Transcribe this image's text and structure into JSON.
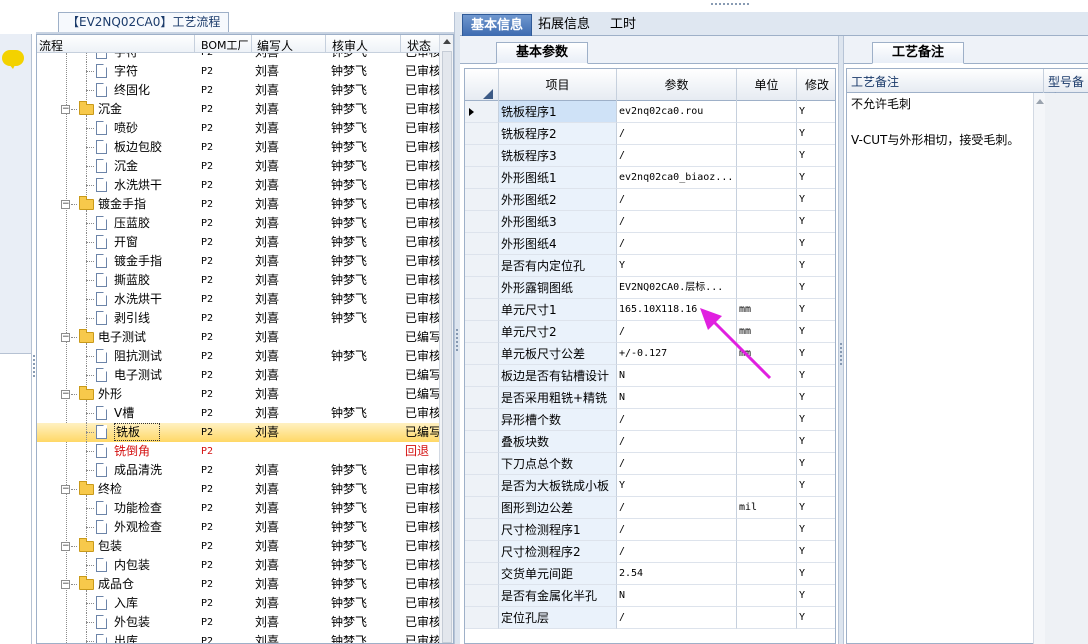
{
  "tree": {
    "title": "【EV2NQ02CA0】工艺流程",
    "headers": [
      "流程",
      "BOM工厂",
      "编写人",
      "核审人",
      "状态"
    ],
    "rows": [
      {
        "level": 2,
        "type": "doc",
        "name": "字符",
        "bom": "P2",
        "writer": "刘喜",
        "reviewer": "钟梦飞",
        "status": "已审核",
        "partial": true
      },
      {
        "level": 2,
        "type": "doc",
        "name": "字符",
        "bom": "P2",
        "writer": "刘喜",
        "reviewer": "钟梦飞",
        "status": "已审核"
      },
      {
        "level": 2,
        "type": "doc",
        "name": "终固化",
        "bom": "P2",
        "writer": "刘喜",
        "reviewer": "钟梦飞",
        "status": "已审核"
      },
      {
        "level": 1,
        "type": "folder",
        "name": "沉金",
        "bom": "P2",
        "writer": "刘喜",
        "reviewer": "钟梦飞",
        "status": "已审核"
      },
      {
        "level": 2,
        "type": "doc",
        "name": "喷砂",
        "bom": "P2",
        "writer": "刘喜",
        "reviewer": "钟梦飞",
        "status": "已审核"
      },
      {
        "level": 2,
        "type": "doc",
        "name": "板边包胶",
        "bom": "P2",
        "writer": "刘喜",
        "reviewer": "钟梦飞",
        "status": "已审核"
      },
      {
        "level": 2,
        "type": "doc",
        "name": "沉金",
        "bom": "P2",
        "writer": "刘喜",
        "reviewer": "钟梦飞",
        "status": "已审核"
      },
      {
        "level": 2,
        "type": "doc",
        "name": "水洗烘干",
        "bom": "P2",
        "writer": "刘喜",
        "reviewer": "钟梦飞",
        "status": "已审核"
      },
      {
        "level": 1,
        "type": "folder",
        "name": "镀金手指",
        "bom": "P2",
        "writer": "刘喜",
        "reviewer": "钟梦飞",
        "status": "已审核"
      },
      {
        "level": 2,
        "type": "doc",
        "name": "压蓝胶",
        "bom": "P2",
        "writer": "刘喜",
        "reviewer": "钟梦飞",
        "status": "已审核"
      },
      {
        "level": 2,
        "type": "doc",
        "name": "开窗",
        "bom": "P2",
        "writer": "刘喜",
        "reviewer": "钟梦飞",
        "status": "已审核"
      },
      {
        "level": 2,
        "type": "doc",
        "name": "镀金手指",
        "bom": "P2",
        "writer": "刘喜",
        "reviewer": "钟梦飞",
        "status": "已审核"
      },
      {
        "level": 2,
        "type": "doc",
        "name": "撕蓝胶",
        "bom": "P2",
        "writer": "刘喜",
        "reviewer": "钟梦飞",
        "status": "已审核"
      },
      {
        "level": 2,
        "type": "doc",
        "name": "水洗烘干",
        "bom": "P2",
        "writer": "刘喜",
        "reviewer": "钟梦飞",
        "status": "已审核"
      },
      {
        "level": 2,
        "type": "doc",
        "name": "剥引线",
        "bom": "P2",
        "writer": "刘喜",
        "reviewer": "钟梦飞",
        "status": "已审核"
      },
      {
        "level": 1,
        "type": "folder",
        "name": "电子测试",
        "bom": "P2",
        "writer": "刘喜",
        "reviewer": "",
        "status": "已编写"
      },
      {
        "level": 2,
        "type": "doc",
        "name": "阻抗测试",
        "bom": "P2",
        "writer": "刘喜",
        "reviewer": "钟梦飞",
        "status": "已审核"
      },
      {
        "level": 2,
        "type": "doc",
        "name": "电子测试",
        "bom": "P2",
        "writer": "刘喜",
        "reviewer": "",
        "status": "已编写"
      },
      {
        "level": 1,
        "type": "folder",
        "name": "外形",
        "bom": "P2",
        "writer": "刘喜",
        "reviewer": "",
        "status": "已编写"
      },
      {
        "level": 2,
        "type": "doc",
        "name": "V槽",
        "bom": "P2",
        "writer": "刘喜",
        "reviewer": "钟梦飞",
        "status": "已审核"
      },
      {
        "level": 2,
        "type": "doc",
        "name": "铣板",
        "bom": "P2",
        "writer": "刘喜",
        "reviewer": "",
        "status": "已编写",
        "selected": true
      },
      {
        "level": 2,
        "type": "doc",
        "name": "铣倒角",
        "bom": "P2",
        "writer": "",
        "reviewer": "",
        "status": "回退",
        "red": true
      },
      {
        "level": 2,
        "type": "doc",
        "name": "成品清洗",
        "bom": "P2",
        "writer": "刘喜",
        "reviewer": "钟梦飞",
        "status": "已审核"
      },
      {
        "level": 1,
        "type": "folder",
        "name": "终检",
        "bom": "P2",
        "writer": "刘喜",
        "reviewer": "钟梦飞",
        "status": "已审核"
      },
      {
        "level": 2,
        "type": "doc",
        "name": "功能检查",
        "bom": "P2",
        "writer": "刘喜",
        "reviewer": "钟梦飞",
        "status": "已审核"
      },
      {
        "level": 2,
        "type": "doc",
        "name": "外观检查",
        "bom": "P2",
        "writer": "刘喜",
        "reviewer": "钟梦飞",
        "status": "已审核"
      },
      {
        "level": 1,
        "type": "folder",
        "name": "包装",
        "bom": "P2",
        "writer": "刘喜",
        "reviewer": "钟梦飞",
        "status": "已审核"
      },
      {
        "level": 2,
        "type": "doc",
        "name": "内包装",
        "bom": "P2",
        "writer": "刘喜",
        "reviewer": "钟梦飞",
        "status": "已审核"
      },
      {
        "level": 1,
        "type": "folder",
        "name": "成品仓",
        "bom": "P2",
        "writer": "刘喜",
        "reviewer": "钟梦飞",
        "status": "已审核"
      },
      {
        "level": 2,
        "type": "doc",
        "name": "入库",
        "bom": "P2",
        "writer": "刘喜",
        "reviewer": "钟梦飞",
        "status": "已审核"
      },
      {
        "level": 2,
        "type": "doc",
        "name": "外包装",
        "bom": "P2",
        "writer": "刘喜",
        "reviewer": "钟梦飞",
        "status": "已审核"
      },
      {
        "level": 2,
        "type": "doc",
        "name": "出库",
        "bom": "P2",
        "writer": "刘喜",
        "reviewer": "钟梦飞",
        "status": "已审核"
      }
    ]
  },
  "tabs": [
    "基本信息",
    "拓展信息",
    "工时"
  ],
  "subtab": "基本参数",
  "grid": {
    "headers": {
      "item": "项目",
      "param": "参数",
      "unit": "单位",
      "modify": "修改"
    },
    "rows": [
      {
        "item": "铣板程序1",
        "param": "ev2nq02ca0.rou",
        "unit": "",
        "modify": "Y"
      },
      {
        "item": "铣板程序2",
        "param": "/",
        "unit": "",
        "modify": "Y"
      },
      {
        "item": "铣板程序3",
        "param": "/",
        "unit": "",
        "modify": "Y"
      },
      {
        "item": "外形图纸1",
        "param": "ev2nq02ca0_biaoz...",
        "unit": "",
        "modify": "Y"
      },
      {
        "item": "外形图纸2",
        "param": "/",
        "unit": "",
        "modify": "Y"
      },
      {
        "item": "外形图纸3",
        "param": "/",
        "unit": "",
        "modify": "Y"
      },
      {
        "item": "外形图纸4",
        "param": "/",
        "unit": "",
        "modify": "Y"
      },
      {
        "item": "是否有内定位孔",
        "param": "Y",
        "unit": "",
        "modify": "Y"
      },
      {
        "item": "外形露铜图纸",
        "param": "EV2NQ02CA0.层标...",
        "unit": "",
        "modify": "Y"
      },
      {
        "item": "单元尺寸1",
        "param": "165.10X118.16",
        "unit": "mm",
        "modify": "Y"
      },
      {
        "item": "单元尺寸2",
        "param": "/",
        "unit": "mm",
        "modify": "Y"
      },
      {
        "item": "单元板尺寸公差",
        "param": "+/-0.127",
        "unit": "mm",
        "modify": "Y"
      },
      {
        "item": "板边是否有钻槽设计",
        "param": "N",
        "unit": "",
        "modify": "Y"
      },
      {
        "item": "是否采用粗铣+精铣",
        "param": "N",
        "unit": "",
        "modify": "Y"
      },
      {
        "item": "异形槽个数",
        "param": "/",
        "unit": "",
        "modify": "Y"
      },
      {
        "item": "叠板块数",
        "param": "/",
        "unit": "",
        "modify": "Y"
      },
      {
        "item": "下刀点总个数",
        "param": "/",
        "unit": "",
        "modify": "Y"
      },
      {
        "item": "是否为大板铣成小板",
        "param": "Y",
        "unit": "",
        "modify": "Y"
      },
      {
        "item": "图形到边公差",
        "param": "/",
        "unit": "mil",
        "modify": "Y"
      },
      {
        "item": "尺寸检测程序1",
        "param": "/",
        "unit": "",
        "modify": "Y"
      },
      {
        "item": "尺寸检测程序2",
        "param": "/",
        "unit": "",
        "modify": "Y"
      },
      {
        "item": "交货单元间距",
        "param": "2.54",
        "unit": "",
        "modify": "Y"
      },
      {
        "item": "是否有金属化半孔",
        "param": "N",
        "unit": "",
        "modify": "Y"
      },
      {
        "item": "定位孔层",
        "param": "/",
        "unit": "",
        "modify": "Y"
      }
    ]
  },
  "note": {
    "tab": "工艺备注",
    "col1": "工艺备注",
    "col2": "型号备注",
    "line1": "不允许毛刺",
    "line2": "V-CUT与外形相切，接受毛刺。"
  },
  "colors": {
    "accent": "#3d6bb0",
    "selected_row": "#ffd866",
    "rollback": "#d41010",
    "annotation_arrow": "#e020e0"
  }
}
